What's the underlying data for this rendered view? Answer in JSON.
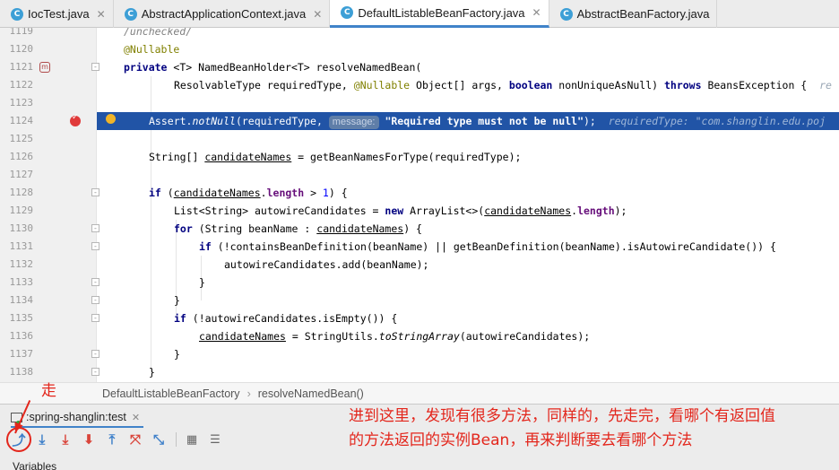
{
  "tabs": [
    {
      "label": "IocTest.java",
      "icon": "class-icon",
      "active": false
    },
    {
      "label": "AbstractApplicationContext.java",
      "icon": "class-icon",
      "active": false
    },
    {
      "label": "DefaultListableBeanFactory.java",
      "icon": "class-icon",
      "active": true
    },
    {
      "label": "AbstractBeanFactory.java",
      "icon": "class-icon",
      "active": false
    }
  ],
  "editor": {
    "line_numbers": [
      "1119",
      "1120",
      "1121",
      "1122",
      "1123",
      "1124",
      "1125",
      "1126",
      "1127",
      "1128",
      "1129",
      "1130",
      "1131",
      "1132",
      "1133",
      "1134",
      "1135",
      "1136",
      "1137",
      "1138"
    ],
    "highlight_line": "1124",
    "param_hint_label": "message:",
    "inline_value": "requiredType: \"com.shanglin.edu.poj"
  },
  "breadcrumb": {
    "class": "DefaultListableBeanFactory",
    "method": "resolveNamedBean()"
  },
  "debug": {
    "session_tab": ":spring-shanglin:test",
    "variables_label": "Variables",
    "toolbar_icons": [
      "show-execution-point-icon",
      "step-over-icon",
      "step-into-icon",
      "force-step-into-icon",
      "step-out-icon",
      "drop-frame-icon",
      "run-to-cursor-icon",
      "evaluate-expression-icon",
      "trace-icon"
    ]
  },
  "annotations": {
    "walk": "走",
    "note_line1": "进到这里，发现有很多方法，同样的，先走完，看哪个有返回值",
    "note_line2": "的方法返回的实例Bean，再来判断要去看哪个方法"
  },
  "colors": {
    "highlight": "#2154a6",
    "annotation_red": "#e3261c",
    "keyword": "#000080"
  }
}
